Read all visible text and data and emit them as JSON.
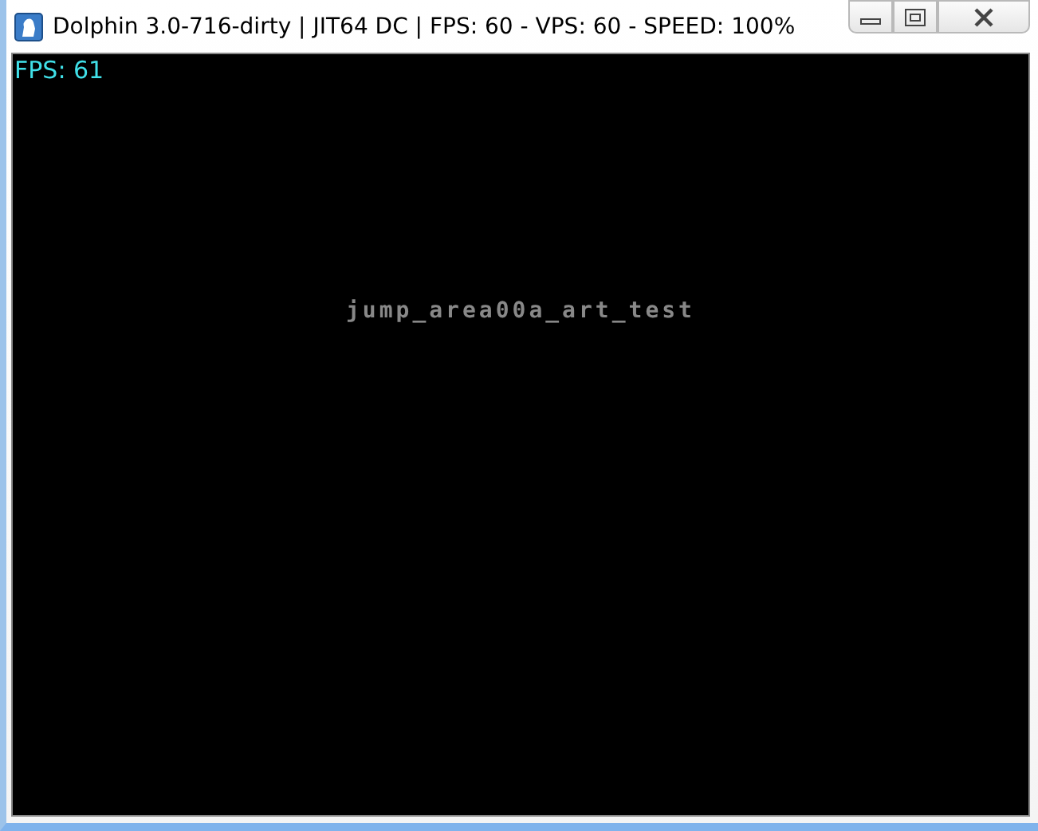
{
  "window": {
    "title": "Dolphin 3.0-716-dirty | JIT64 DC | FPS: 60 - VPS: 60 - SPEED: 100%"
  },
  "render": {
    "fps_overlay": "FPS: 61",
    "message": "jump_area00a_art_test"
  }
}
